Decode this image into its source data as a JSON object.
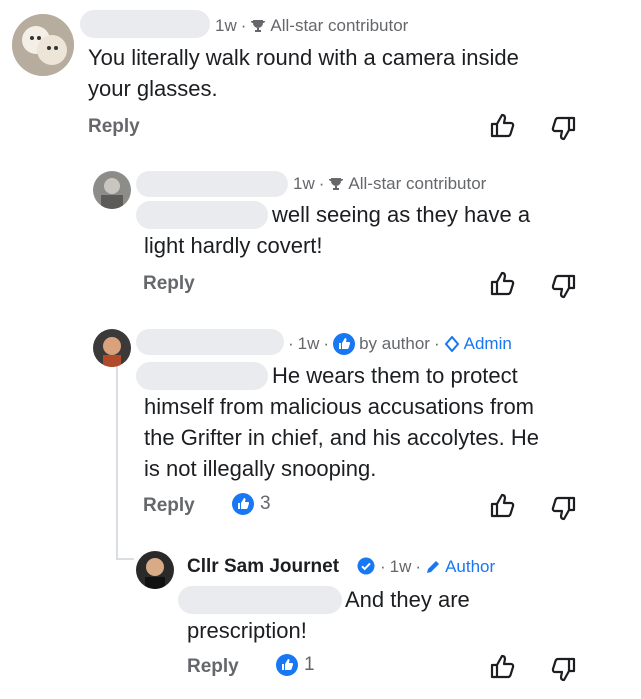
{
  "comments": [
    {
      "time": "1w",
      "badge": "All-star contributor",
      "text_lines": [
        "You literally walk round with a camera inside",
        "your glasses."
      ],
      "reply": "Reply"
    },
    {
      "time": "1w",
      "badge": "All-star contributor",
      "text_lines": [
        "well seeing as they have a",
        "light hardly covert!"
      ],
      "reply": "Reply"
    },
    {
      "time": "1w",
      "by_author": "by author",
      "admin": "Admin",
      "text_lines": [
        "He wears them to protect",
        "himself from malicious accusations from",
        "the Grifter in chief, and his accolytes.  He",
        "is not illegally snooping."
      ],
      "reply": "Reply",
      "likes": "3"
    },
    {
      "name": "Cllr Sam Journet",
      "time": "1w",
      "author_label": "Author",
      "text_lines": [
        "And they are",
        "prescription!"
      ],
      "reply": "Reply",
      "likes": "1"
    }
  ],
  "colors": {
    "accent": "#1877f2",
    "muted": "#65676b",
    "redaction": "#e9ebee"
  }
}
